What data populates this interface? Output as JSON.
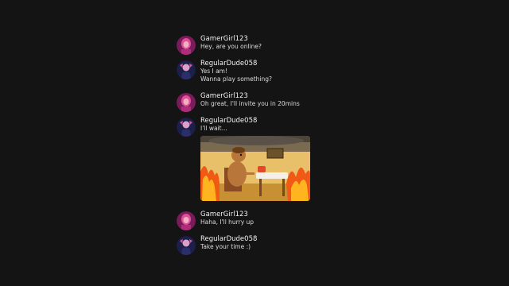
{
  "messages": [
    {
      "user": "GamerGirl123",
      "avatar": "gamergirl-avatar",
      "lines": [
        "Hey, are you online?"
      ]
    },
    {
      "user": "RegularDude058",
      "avatar": "regulardude-avatar",
      "lines": [
        "Yes I am!",
        "Wanna play something?"
      ]
    },
    {
      "user": "GamerGirl123",
      "avatar": "gamergirl-avatar",
      "lines": [
        "Oh great, I'll invite you in 20mins"
      ]
    },
    {
      "user": "RegularDude058",
      "avatar": "regulardude-avatar",
      "lines": [
        "I'll wait..."
      ],
      "attachment": "this-is-fine-meme-image"
    },
    {
      "user": "GamerGirl123",
      "avatar": "gamergirl-avatar",
      "lines": [
        "Haha, I'll hurry up"
      ]
    },
    {
      "user": "RegularDude058",
      "avatar": "regulardude-avatar",
      "lines": [
        "Take your time :)"
      ]
    }
  ],
  "colors": {
    "background": "#141414",
    "username": "#f0f0f0",
    "text": "#dcdcdc"
  }
}
